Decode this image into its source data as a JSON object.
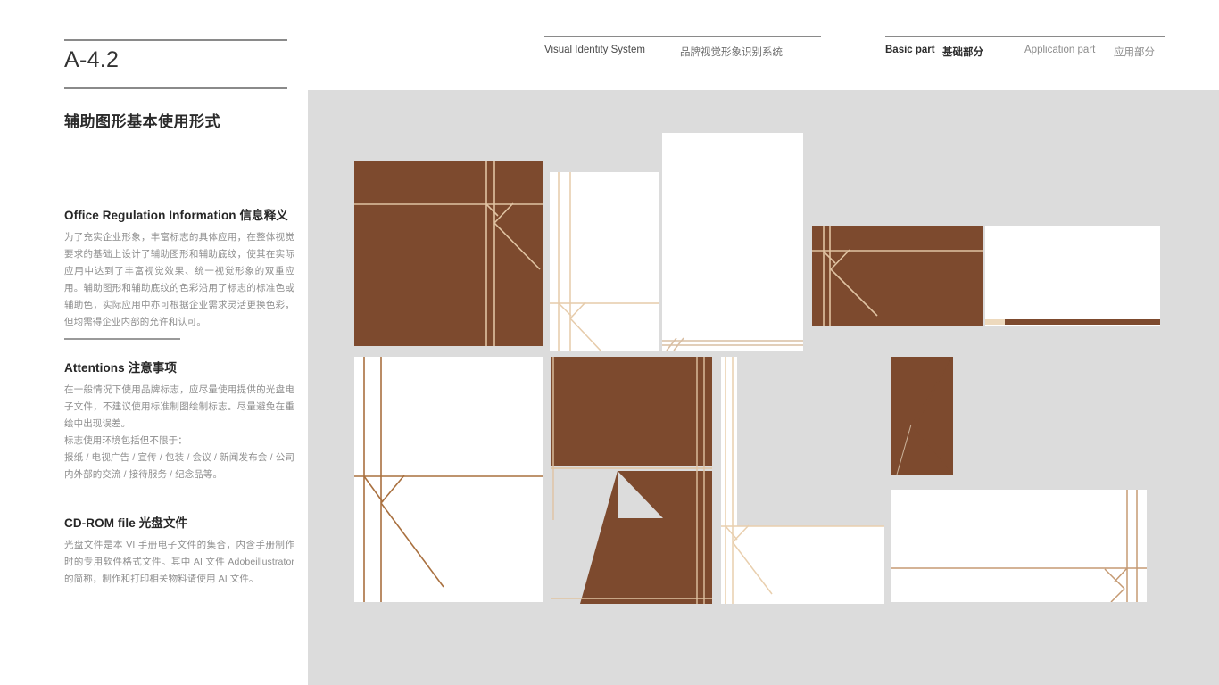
{
  "page": {
    "code": "A-4.2",
    "section_title": "辅助图形基本使用形式",
    "background_color": "#DCDCDC",
    "brand_brown": "#7D4A2E",
    "line_tan": "#E0C3A2",
    "line_dark_tan": "#A9703F"
  },
  "nav": {
    "items": [
      {
        "name": "visual-identity-system",
        "label": "Visual Identity System"
      },
      {
        "name": "visual-identity-system-cn",
        "label": "品牌视觉形象识别系统"
      },
      {
        "name": "basic-part",
        "label": "Basic part"
      },
      {
        "name": "basic-part-cn",
        "label": "基础部分"
      },
      {
        "name": "application-part",
        "label": "Application part"
      },
      {
        "name": "application-part-cn",
        "label": "应用部分"
      }
    ]
  },
  "sidebar": {
    "blocks": [
      {
        "id": "office",
        "heading": "Office Regulation Information 信息释义",
        "body": "为了充实企业形象，丰富标志的具体应用，在整体视觉要求的基础上设计了辅助图形和辅助底纹，使其在实际应用中达到了丰富视觉效果、统一视觉形象的双重应用。辅助图形和辅助底纹的色彩沿用了标志的标准色或辅助色，实际应用中亦可根据企业需求灵活更换色彩，但均需得企业内部的允许和认可。"
      },
      {
        "id": "attentions",
        "heading": "Attentions 注意事项",
        "body": "在一般情况下使用品牌标志，应尽量使用提供的光盘电子文件，不建议使用标准制图绘制标志。尽量避免在重绘中出现误差。\n标志使用环境包括但不限于：\n报纸 / 电视广告 / 宣传 / 包装 / 会议 / 新闻发布会 / 公司内外部的交流 / 接待服务 / 纪念品等。"
      },
      {
        "id": "cdrom",
        "heading": "CD-ROM file 光盘文件",
        "body": "光盘文件是本 VI 手册电子文件的集合，内含手册制作时的专用软件格式文件。其中 AI 文件 Adobeillustrator 的简称，制作和打印相关物料请使用 AI 文件。"
      }
    ]
  },
  "canvas": {
    "cards": [
      {
        "id": "card1",
        "name": "graphic-card-brown-square",
        "fill": "#7D4A2E",
        "mark": "k-light"
      },
      {
        "id": "card2",
        "name": "graphic-card-white-portrait",
        "fill": "#FFFFFF",
        "mark": "k-tan-bottom"
      },
      {
        "id": "card3",
        "name": "graphic-card-white-tall",
        "fill": "#FFFFFF",
        "mark": "baseline-slashes"
      },
      {
        "id": "card4",
        "name": "graphic-card-brown-landscape",
        "fill": "#7D4A2E",
        "mark": "k-light"
      },
      {
        "id": "card5",
        "name": "graphic-card-white-landscape",
        "fill": "#FFFFFF",
        "mark": "brown-footer-bar"
      },
      {
        "id": "card6",
        "name": "graphic-card-white-k-outline",
        "fill": "#FFFFFF",
        "mark": "k-dark-outline"
      },
      {
        "id": "card7",
        "name": "graphic-card-brown-solid-k",
        "fill": "#7D4A2E",
        "mark": "solid-k-negative"
      },
      {
        "id": "card8",
        "name": "graphic-card-transparent-strip",
        "fill": "#DCDCDC",
        "mark": "k-tan-bottom-right"
      },
      {
        "id": "card9",
        "name": "graphic-card-brown-arrow-k",
        "fill": "#7D4A2E",
        "mark": "solid-arrow-k"
      },
      {
        "id": "card10",
        "name": "graphic-card-white-wide-footer",
        "fill": "#FFFFFF",
        "mark": "k-mirrored-right"
      }
    ]
  }
}
